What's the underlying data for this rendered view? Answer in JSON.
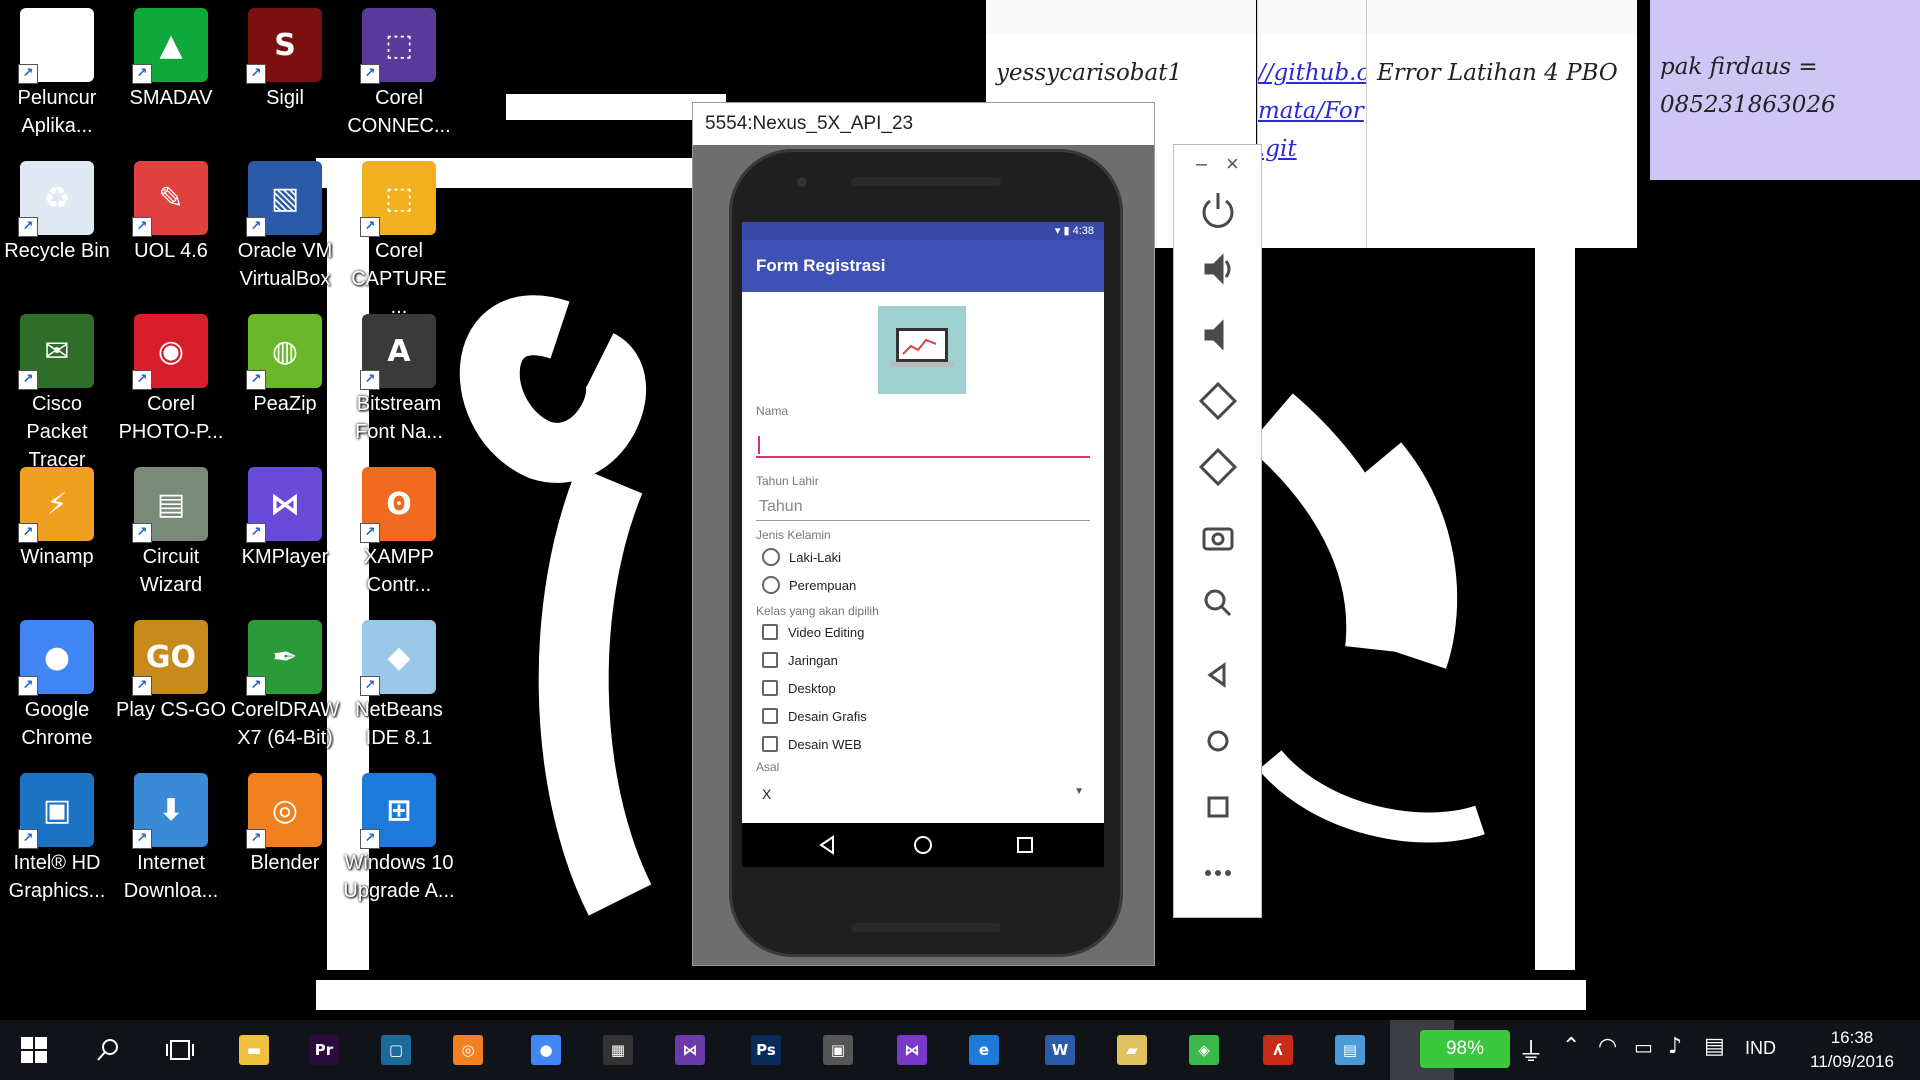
{
  "desktop_icons": [
    {
      "label": "Peluncur\nAplika...",
      "icon": "app-launcher-icon",
      "color": "#ffffff",
      "glyph": "▦"
    },
    {
      "label": "Recycle Bin",
      "icon": "recycle-bin-icon",
      "color": "#dfe9f3",
      "glyph": "♻"
    },
    {
      "label": "Cisco Packet\nTracer",
      "icon": "cisco-packet-tracer-icon",
      "color": "#2f6e2a",
      "glyph": "✉"
    },
    {
      "label": "Winamp",
      "icon": "winamp-icon",
      "color": "#f0a020",
      "glyph": "⚡"
    },
    {
      "label": "Google\nChrome",
      "icon": "chrome-icon",
      "color": "#4285f4",
      "glyph": "●"
    },
    {
      "label": "Intel® HD\nGraphics...",
      "icon": "intel-graphics-icon",
      "color": "#1c73c4",
      "glyph": "▣"
    },
    {
      "label": "SMADAV",
      "icon": "smadav-icon",
      "color": "#0fa83a",
      "glyph": "▲"
    },
    {
      "label": "UOL 4.6",
      "icon": "uol-icon",
      "color": "#e04040",
      "glyph": "✎"
    },
    {
      "label": "Corel\nPHOTO-P...",
      "icon": "corel-photo-paint-icon",
      "color": "#d81e2a",
      "glyph": "◉"
    },
    {
      "label": "Circuit\nWizard",
      "icon": "circuit-wizard-icon",
      "color": "#7a8a7a",
      "glyph": "▤"
    },
    {
      "label": "Play CS-GO",
      "icon": "csgo-icon",
      "color": "#c88a1a",
      "glyph": "GO"
    },
    {
      "label": "Internet\nDownloa...",
      "icon": "internet-download-manager-icon",
      "color": "#3a8ad8",
      "glyph": "⬇"
    },
    {
      "label": "Sigil",
      "icon": "sigil-icon",
      "color": "#7a1010",
      "glyph": "S"
    },
    {
      "label": "Oracle VM\nVirtualBox",
      "icon": "virtualbox-icon",
      "color": "#2a5aa8",
      "glyph": "▧"
    },
    {
      "label": "PeaZip",
      "icon": "peazip-icon",
      "color": "#6ab82a",
      "glyph": "◍"
    },
    {
      "label": "KMPlayer",
      "icon": "kmplayer-icon",
      "color": "#6a4ad8",
      "glyph": "⋈"
    },
    {
      "label": "CorelDRAW\nX7 (64-Bit)",
      "icon": "coreldraw-icon",
      "color": "#2a9a3a",
      "glyph": "✒"
    },
    {
      "label": "Blender",
      "icon": "blender-icon",
      "color": "#f08020",
      "glyph": "◎"
    },
    {
      "label": "Corel\nCONNEC...",
      "icon": "corel-connect-icon",
      "color": "#5a3a9a",
      "glyph": "⬚"
    },
    {
      "label": "Corel\nCAPTURE ...",
      "icon": "corel-capture-icon",
      "color": "#f0b020",
      "glyph": "⬚"
    },
    {
      "label": "Bitstream\nFont Na...",
      "icon": "bitstream-font-navigator-icon",
      "color": "#3a3a3a",
      "glyph": "A"
    },
    {
      "label": "XAMPP\nContr...",
      "icon": "xampp-icon",
      "color": "#f06a20",
      "glyph": "ʘ"
    },
    {
      "label": "NetBeans\nIDE 8.1",
      "icon": "netbeans-icon",
      "color": "#9ac8e8",
      "glyph": "◆"
    },
    {
      "label": "Windows 10\nUpgrade A...",
      "icon": "windows-10-upgrade-icon",
      "color": "#1e7ad8",
      "glyph": "⊞"
    }
  ],
  "sticky_notes": [
    {
      "text": "yessycarisobat1",
      "color": "#ffffff",
      "is_link": false
    },
    {
      "text": "//github.c\nmata/For\n.git",
      "color": "#ffffff",
      "is_link": true
    },
    {
      "text": "Error Latihan 4 PBO",
      "color": "#ffffff",
      "is_link": false
    },
    {
      "text": "pak firdaus =\n085231863026",
      "color": "#cfc6f5",
      "is_link": false
    }
  ],
  "emulator": {
    "window_title": "5554:Nexus_5X_API_23",
    "status_time": "4:38",
    "app_title": "Form Registrasi",
    "form": {
      "nama_label": "Nama",
      "nama_value": "",
      "tahun_label": "Tahun Lahir",
      "tahun_placeholder": "Tahun",
      "gender_label": "Jenis Kelamin",
      "gender_options": [
        "Laki-Laki",
        "Perempuan"
      ],
      "kelas_label": "Kelas yang akan dipilih",
      "kelas_options": [
        "Video Editing",
        "Jaringan",
        "Desktop",
        "Desain Grafis",
        "Desain WEB"
      ],
      "asal_label": "Asal",
      "asal_value": "X"
    },
    "toolbar": {
      "minimize": "–",
      "close": "×",
      "buttons": [
        "power-icon",
        "volume-up-icon",
        "volume-down-icon",
        "rotate-left-icon",
        "rotate-right-icon",
        "camera-icon",
        "zoom-icon",
        "back-icon",
        "home-icon",
        "overview-icon",
        "more-icon"
      ]
    }
  },
  "taskbar": {
    "pinned": [
      {
        "icon": "file-explorer-icon",
        "color": "#f0c040",
        "glyph": "▬"
      },
      {
        "icon": "premiere-icon",
        "color": "#2a0a3a",
        "glyph": "Pr"
      },
      {
        "icon": "app-tile-icon",
        "color": "#1a6a9a",
        "glyph": "▢"
      },
      {
        "icon": "blender-taskbar-icon",
        "color": "#f08020",
        "glyph": "◎"
      },
      {
        "icon": "chrome-taskbar-icon",
        "color": "#4285f4",
        "glyph": "●"
      },
      {
        "icon": "calculator-icon",
        "color": "#333333",
        "glyph": "▦"
      },
      {
        "icon": "visual-studio-icon",
        "color": "#6a3aa8",
        "glyph": "⋈"
      },
      {
        "icon": "photoshop-icon",
        "color": "#0a2a5a",
        "glyph": "Ps"
      },
      {
        "icon": "store-icon",
        "color": "#555555",
        "glyph": "▣"
      },
      {
        "icon": "visual-studio-2-icon",
        "color": "#7a3ac8",
        "glyph": "⋈"
      },
      {
        "icon": "edge-icon",
        "color": "#1e7ad8",
        "glyph": "e"
      },
      {
        "icon": "word-icon",
        "color": "#2a5aa8",
        "glyph": "W"
      },
      {
        "icon": "folder-icon",
        "color": "#e0c060",
        "glyph": "▰"
      },
      {
        "icon": "android-studio-icon",
        "color": "#3ab84a",
        "glyph": "◈"
      },
      {
        "icon": "adobe-reader-icon",
        "color": "#c82a1a",
        "glyph": "ʎ"
      },
      {
        "icon": "control-panel-icon",
        "color": "#4a9ad8",
        "glyph": "▤"
      }
    ],
    "battery": "98%",
    "language": "IND",
    "time": "16:38",
    "date": "11/09/2016"
  }
}
